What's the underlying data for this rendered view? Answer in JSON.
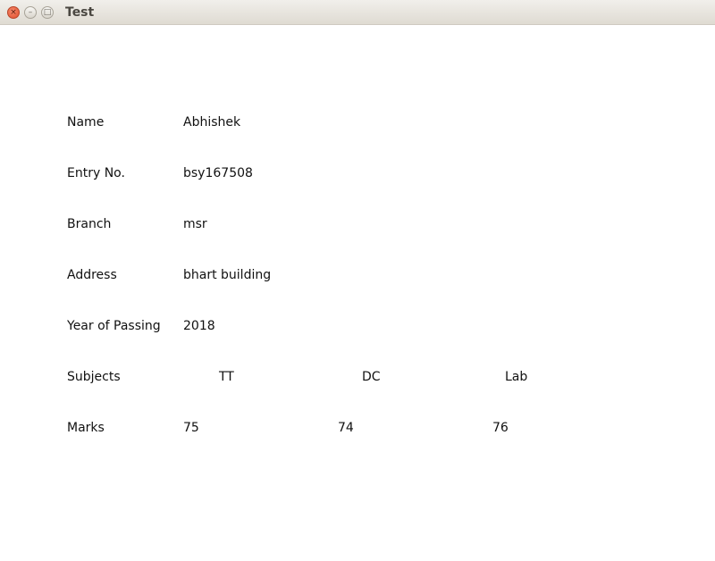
{
  "window": {
    "title": "Test"
  },
  "form": {
    "name": {
      "label": "Name",
      "value": "Abhishek"
    },
    "entry": {
      "label": "Entry No.",
      "value": "bsy167508"
    },
    "branch": {
      "label": "Branch",
      "value": "msr"
    },
    "address": {
      "label": "Address",
      "value": "bhart building"
    },
    "year": {
      "label": "Year of Passing",
      "value": "2018"
    },
    "subjects": {
      "label": "Subjects",
      "items": [
        "TT",
        "DC",
        "Lab"
      ]
    },
    "marks": {
      "label": "Marks",
      "items": [
        "75",
        "74",
        "76"
      ]
    }
  },
  "icons": {
    "close": "close-icon",
    "minimize": "minimize-icon",
    "maximize": "maximize-icon"
  },
  "colors": {
    "close_button": "#e0502c",
    "titlebar": "#dfdbd2",
    "text": "#111111"
  }
}
